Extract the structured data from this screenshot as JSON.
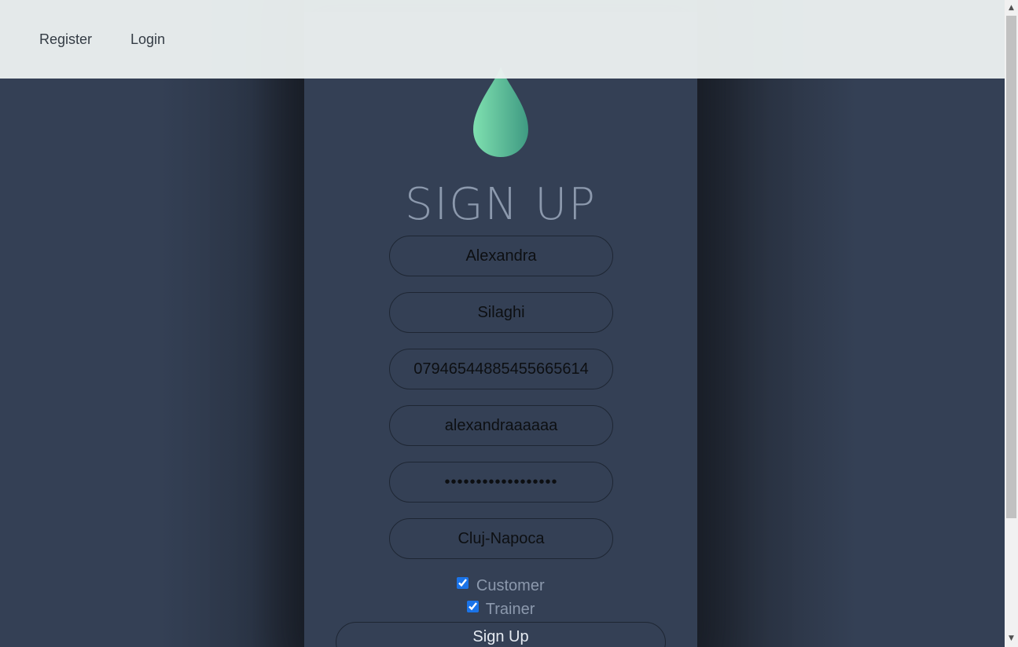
{
  "nav": {
    "register_label": "Register",
    "login_label": "Login"
  },
  "logo": {
    "icon": "water-drop-icon",
    "color_light": "#7fe0b0",
    "color_dark": "#3f9a82"
  },
  "form": {
    "title": "SIGN UP",
    "first_name": "Alexandra",
    "last_name": "Silaghi",
    "phone": "07946544885455665614",
    "username": "alexandraaaaaa",
    "password": "••••••••••••••••••",
    "city": "Cluj-Napoca",
    "customer_label": "Customer",
    "customer_checked": true,
    "trainer_label": "Trainer",
    "trainer_checked": true,
    "submit_label": "Sign Up"
  },
  "colors": {
    "background": "#344055",
    "navbar": "#ebf0f0",
    "title": "#8c99ad",
    "checkbox_accent": "#1a73e8"
  }
}
